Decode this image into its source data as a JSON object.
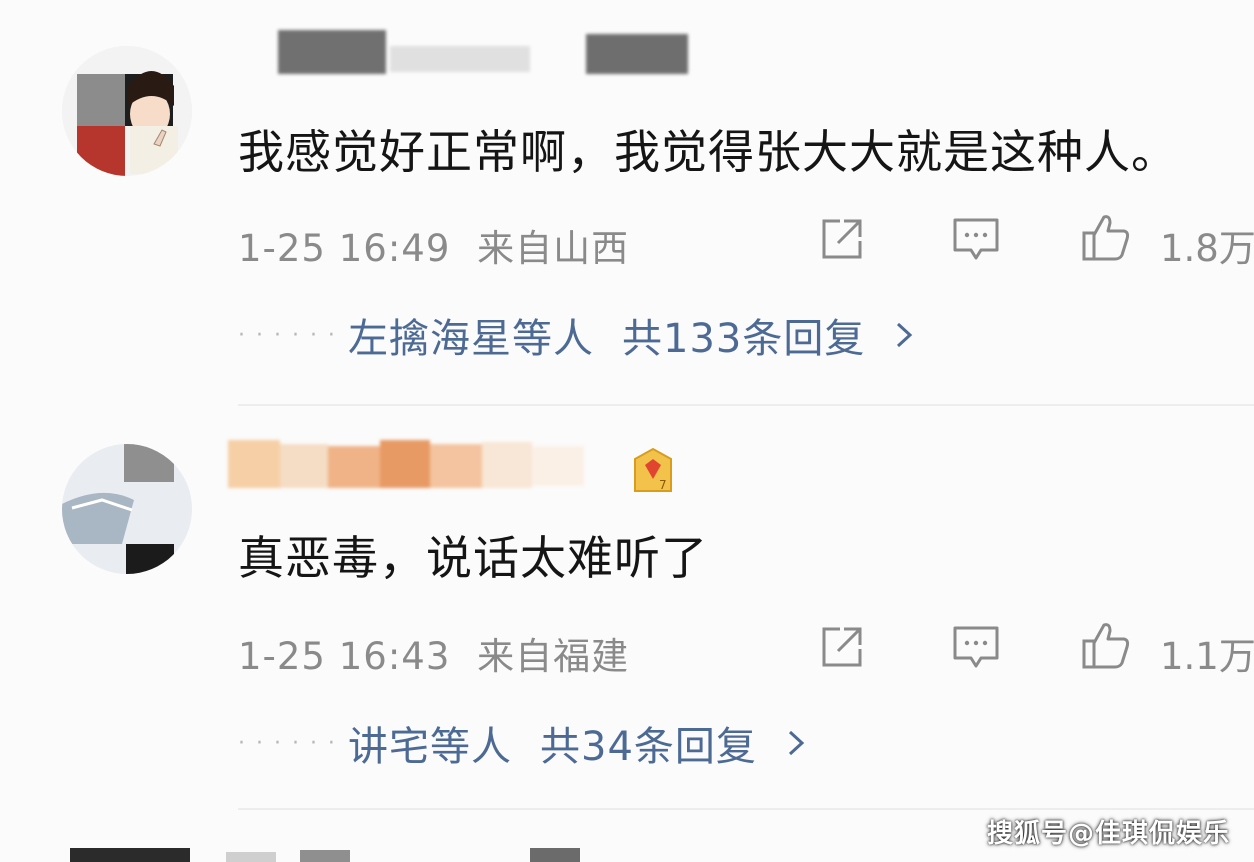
{
  "comments": [
    {
      "text": "我感觉好正常啊，我觉得张大大就是这种人。",
      "timestamp": "1-25 16:49",
      "location": "来自山西",
      "likes": "1.8万",
      "reply_users": "左擒海星等人",
      "reply_count": "共133条回复"
    },
    {
      "text": "真恶毒，说话太难听了",
      "timestamp": "1-25 16:43",
      "location": "来自福建",
      "likes": "1.1万",
      "reply_users": "讲宅等人",
      "reply_count": "共34条回复"
    }
  ],
  "icons": {
    "share": "share-icon",
    "comment": "comment-icon",
    "like": "thumbs-up-icon",
    "more_replies": "chevron-right-icon",
    "badge": "gold-badge-icon"
  },
  "colors": {
    "reply_link": "#4d6a95",
    "meta_text": "#8a8a8a",
    "body_text": "#151515"
  },
  "watermark": "搜狐号@佳琪侃娱乐"
}
